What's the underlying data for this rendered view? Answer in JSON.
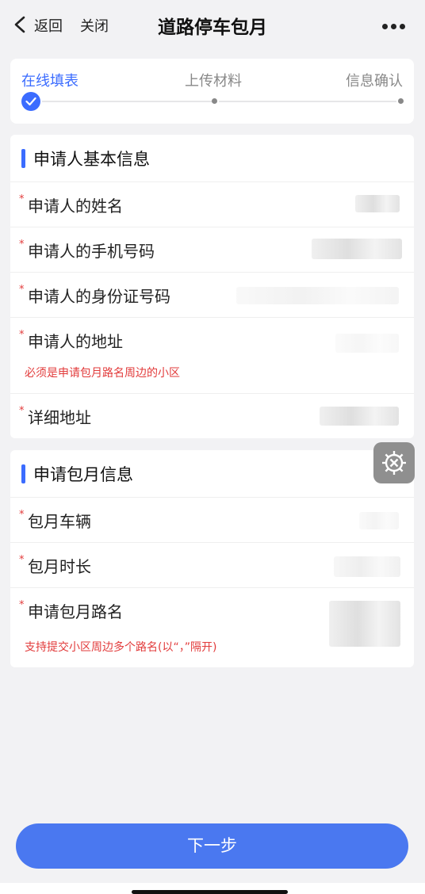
{
  "nav": {
    "back_label": "返回",
    "close_label": "关闭",
    "title": "道路停车包月"
  },
  "steps": [
    {
      "label": "在线填表",
      "state": "done"
    },
    {
      "label": "上传材料",
      "state": "pending"
    },
    {
      "label": "信息确认",
      "state": "pending"
    }
  ],
  "applicant": {
    "section_title": "申请人基本信息",
    "fields": [
      {
        "required_mark": "*",
        "label": "申请人的姓名"
      },
      {
        "required_mark": "*",
        "label": "申请人的手机号码"
      },
      {
        "required_mark": "*",
        "label": "申请人的身份证号码"
      },
      {
        "required_mark": "*",
        "label": "申请人的地址",
        "hint": "必须是申请包月路名周边的小区"
      },
      {
        "required_mark": "*",
        "label": "详细地址"
      }
    ]
  },
  "monthly": {
    "section_title": "申请包月信息",
    "fields": [
      {
        "required_mark": "*",
        "label": "包月车辆"
      },
      {
        "required_mark": "*",
        "label": "包月时长"
      },
      {
        "required_mark": "*",
        "label": "申请包月路名",
        "hint": "支持提交小区周边多个路名(以“，”隔开)"
      }
    ]
  },
  "actions": {
    "next_label": "下一步"
  },
  "colors": {
    "accent": "#3b6cff",
    "button": "#4a78f0",
    "required": "#e23b3b",
    "background": "#f2f2f4"
  },
  "icons": {
    "back": "chevron-left-icon",
    "more": "more-horizontal-icon",
    "step_done": "check-circle-icon",
    "float": "gear-tool-icon"
  }
}
